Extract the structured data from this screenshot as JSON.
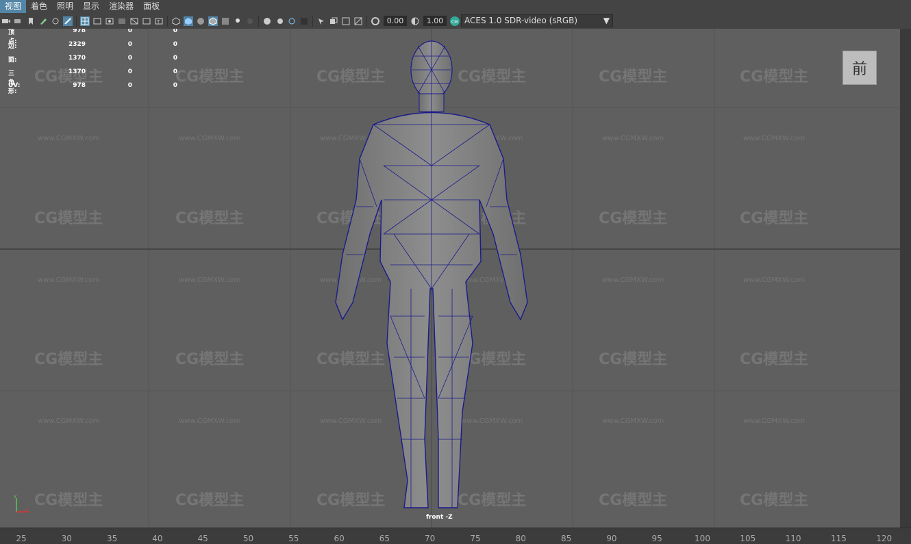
{
  "menu": [
    "视图",
    "着色",
    "照明",
    "显示",
    "渲染器",
    "面板"
  ],
  "toolbar": {
    "field1": "0.00",
    "field2": "1.00",
    "colorspace": "ACES 1.0 SDR-video (sRGB)"
  },
  "hud": {
    "rows": [
      {
        "label": "顶点:",
        "v1": "978",
        "v2": "0",
        "v3": "0"
      },
      {
        "label": "边:",
        "v1": "2329",
        "v2": "0",
        "v3": "0"
      },
      {
        "label": "面:",
        "v1": "1370",
        "v2": "0",
        "v3": "0"
      },
      {
        "label": "三角形:",
        "v1": "1370",
        "v2": "0",
        "v3": "0"
      },
      {
        "label": "UV:",
        "v1": "978",
        "v2": "0",
        "v3": "0"
      }
    ]
  },
  "viewcube": "前",
  "camera": "front -Z",
  "watermark": {
    "logo": "CG模型主",
    "url": "www.CGMXW.com"
  },
  "ruler": [
    "25",
    "30",
    "35",
    "40",
    "45",
    "50",
    "55",
    "60",
    "65",
    "70",
    "75",
    "80",
    "85",
    "90",
    "95",
    "100",
    "105",
    "110",
    "115",
    "120"
  ]
}
